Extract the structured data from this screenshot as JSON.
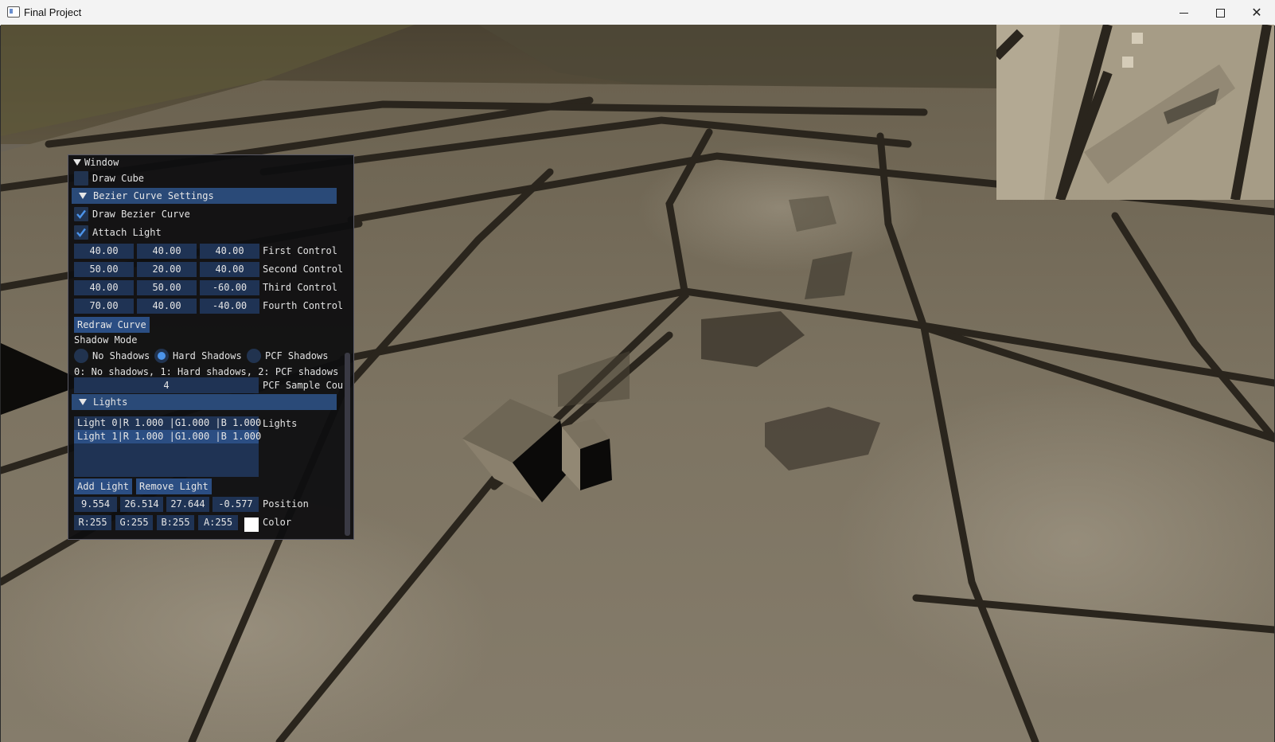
{
  "window": {
    "title": "Final Project",
    "controls": [
      "minimize",
      "maximize",
      "close"
    ]
  },
  "viewport": {
    "description_icons": [
      "stone-floor",
      "cube",
      "minimap"
    ]
  },
  "panel": {
    "title": "Window",
    "draw_cube": {
      "label": "Draw Cube",
      "checked": false
    },
    "bezier_header": "Bezier Curve Settings",
    "draw_bezier": {
      "label": "Draw Bezier Curve",
      "checked": true
    },
    "attach_light": {
      "label": "Attach Light",
      "checked": true
    },
    "controls": [
      {
        "values": [
          "40.00",
          "40.00",
          "40.00"
        ],
        "label": "First Control"
      },
      {
        "values": [
          "50.00",
          "20.00",
          "40.00"
        ],
        "label": "Second Control"
      },
      {
        "values": [
          "40.00",
          "50.00",
          "-60.00"
        ],
        "label": "Third Control"
      },
      {
        "values": [
          "70.00",
          "40.00",
          "-40.00"
        ],
        "label": "Fourth Control"
      }
    ],
    "redraw_label": "Redraw Curve",
    "shadow_mode_label": "Shadow Mode",
    "shadow_options": [
      {
        "label": "No Shadows",
        "selected": false
      },
      {
        "label": "Hard Shadows",
        "selected": true
      },
      {
        "label": "PCF Shadows",
        "selected": false
      }
    ],
    "shadow_help": "0: No shadows, 1: Hard shadows, 2: PCF shadows",
    "pcf_value": "4",
    "pcf_label": "PCF Sample Cou",
    "lights_header": "Lights",
    "lights": [
      {
        "text": "Light 0|R 1.000 |G1.000 |B 1.000",
        "selected": false
      },
      {
        "text": "Light 1|R 1.000 |G1.000 |B 1.000",
        "selected": true
      }
    ],
    "lights_label": "Lights",
    "add_light": "Add Light",
    "remove_light": "Remove Light",
    "position": {
      "values": [
        "9.554",
        "26.514",
        "27.644",
        "-0.577"
      ],
      "label": "Position"
    },
    "color": {
      "values": [
        "R:255",
        "G:255",
        "B:255",
        "A:255"
      ],
      "label": "Color",
      "swatch": "#ffffff"
    }
  },
  "colors": {
    "frame_bg": "#1f3354",
    "header_bg": "#2a4a78",
    "button_bg": "#2b4e83",
    "check_mark": "#4c94ea"
  }
}
